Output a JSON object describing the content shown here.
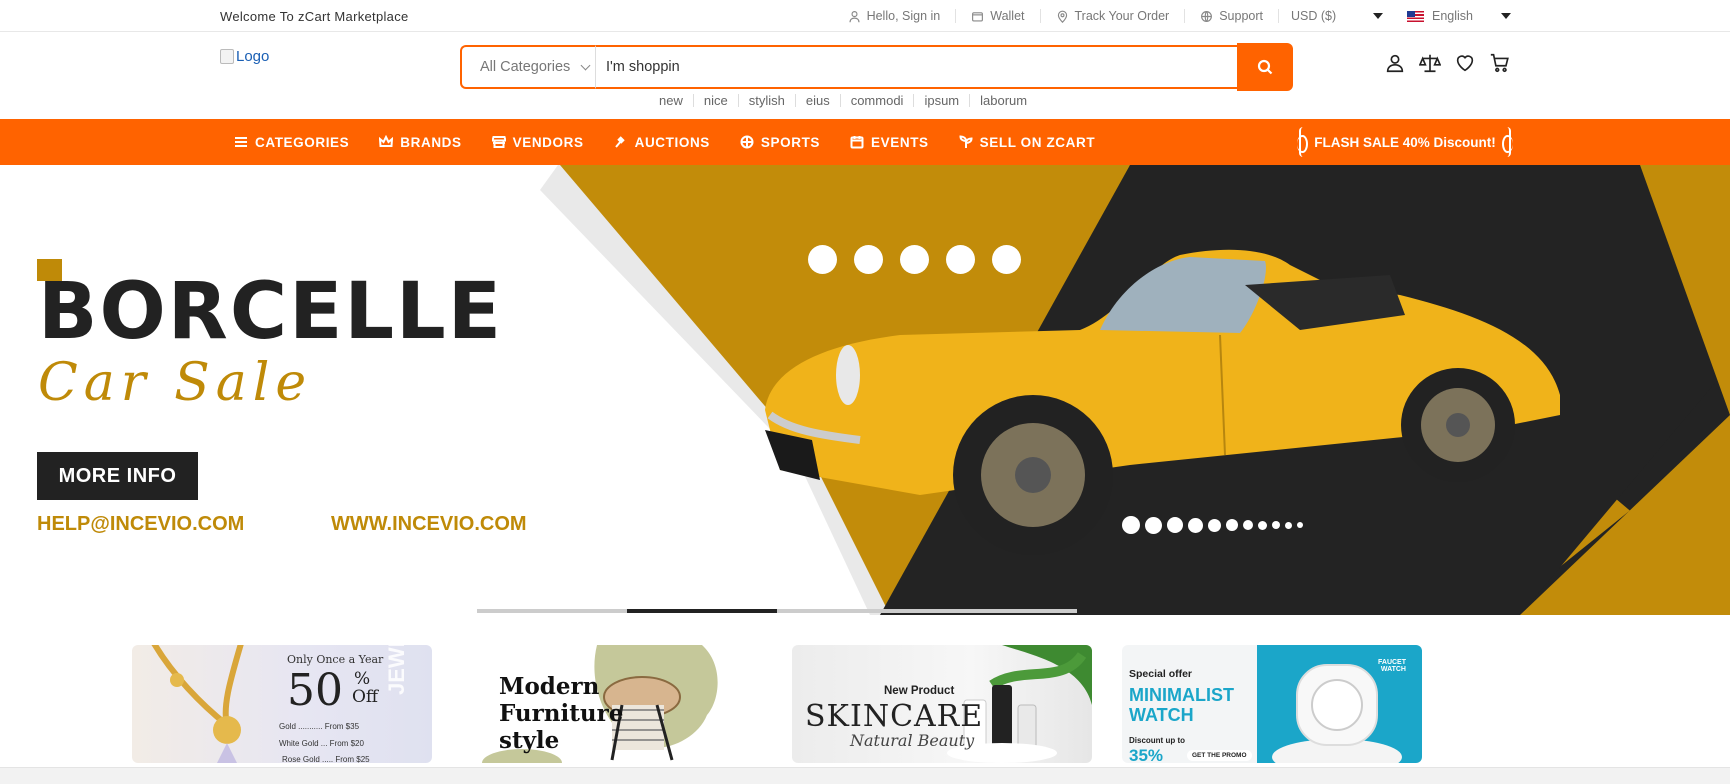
{
  "topbar": {
    "welcome": "Welcome To zCart Marketplace",
    "links": [
      {
        "label": "Hello, Sign in",
        "icon": "user-icon"
      },
      {
        "label": "Wallet",
        "icon": "wallet-icon"
      },
      {
        "label": "Track Your Order",
        "icon": "map-pin-icon"
      },
      {
        "label": "Support",
        "icon": "globe-icon"
      }
    ],
    "currency": "USD ($)",
    "language": "English"
  },
  "header": {
    "logo_alt": "Logo",
    "search": {
      "category": "All Categories",
      "value": "I'm shoppin"
    },
    "tags": [
      "new",
      "nice",
      "stylish",
      "eius",
      "commodi",
      "ipsum",
      "laborum"
    ]
  },
  "nav": {
    "items": [
      {
        "label": "CATEGORIES",
        "icon": "menu-icon"
      },
      {
        "label": "BRANDS",
        "icon": "crown-icon"
      },
      {
        "label": "VENDORS",
        "icon": "store-icon"
      },
      {
        "label": "AUCTIONS",
        "icon": "gavel-icon"
      },
      {
        "label": "SPORTS",
        "icon": "basketball-icon"
      },
      {
        "label": "EVENTS",
        "icon": "calendar-icon"
      },
      {
        "label": "SELL ON ZCART",
        "icon": "seedling-icon"
      }
    ],
    "flash": "FLASH SALE 40% Discount!"
  },
  "hero": {
    "brand": "BORCELLE",
    "subtitle": "Car Sale",
    "button": "MORE INFO",
    "email": "HELP@INCEVIO.COM",
    "website": "WWW.INCEVIO.COM",
    "slider_active_index": 1,
    "slider_count": 4,
    "colors": {
      "gold": "#bf8a08",
      "dark": "#222222",
      "accent": "#ff6300"
    }
  },
  "promos": [
    {
      "line1": "Only Once a Year",
      "big": "50",
      "unit": "%",
      "off": "Off",
      "rows": [
        "Gold ........... From $35",
        "White Gold ... From $20",
        "Rose Gold ..... From $25"
      ],
      "side": "JEWERLY"
    },
    {
      "title1": "Modern",
      "title2": "Furniture",
      "title3": "style"
    },
    {
      "line1": "New Product",
      "title": "SKINCARE",
      "script": "Natural Beauty"
    },
    {
      "line1": "Special offer",
      "title1": "MINIMALIST",
      "title2": "WATCH",
      "discount": "Discount up to",
      "percent": "35%",
      "cta": "GET THE PROMO",
      "brand": "FAUCET WATCH"
    }
  ]
}
